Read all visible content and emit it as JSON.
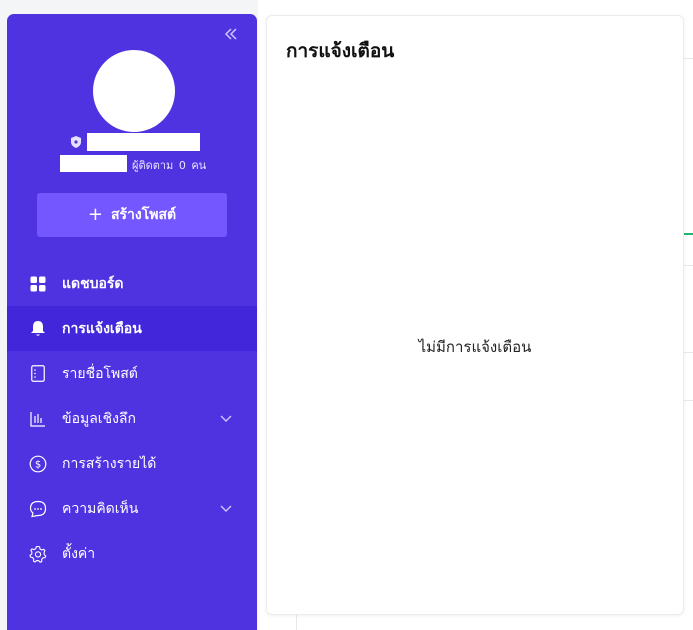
{
  "sidebar": {
    "collapse_icon": "double-chevron-left-icon",
    "profile": {
      "followers_label": "ผู้ติดตาม",
      "followers_count": "0",
      "followers_unit": "คน"
    },
    "create_post_label": "สร้างโพสต์",
    "menu": [
      {
        "label": "แดชบอร์ด",
        "icon": "dashboard-grid-icon"
      },
      {
        "label": "การแจ้งเตือน",
        "icon": "bell-icon",
        "active": true
      },
      {
        "label": "รายชื่อโพสต์",
        "icon": "post-list-icon"
      },
      {
        "label": "ข้อมูลเชิงลึก",
        "icon": "bar-chart-icon",
        "expandable": true
      },
      {
        "label": "การสร้างรายได้",
        "icon": "dollar-circle-icon"
      },
      {
        "label": "ความคิดเห็น",
        "icon": "comment-bubble-icon",
        "expandable": true
      },
      {
        "label": "ตั้งค่า",
        "icon": "gear-icon"
      }
    ]
  },
  "notifications": {
    "title": "การแจ้งเตือน",
    "empty_message": "ไม่มีการแจ้งเตือน"
  },
  "colors": {
    "sidebar_bg": "#4f33e0",
    "sidebar_active": "#4127d9",
    "button_bg": "#7557ff",
    "accent_green": "#22b573"
  }
}
